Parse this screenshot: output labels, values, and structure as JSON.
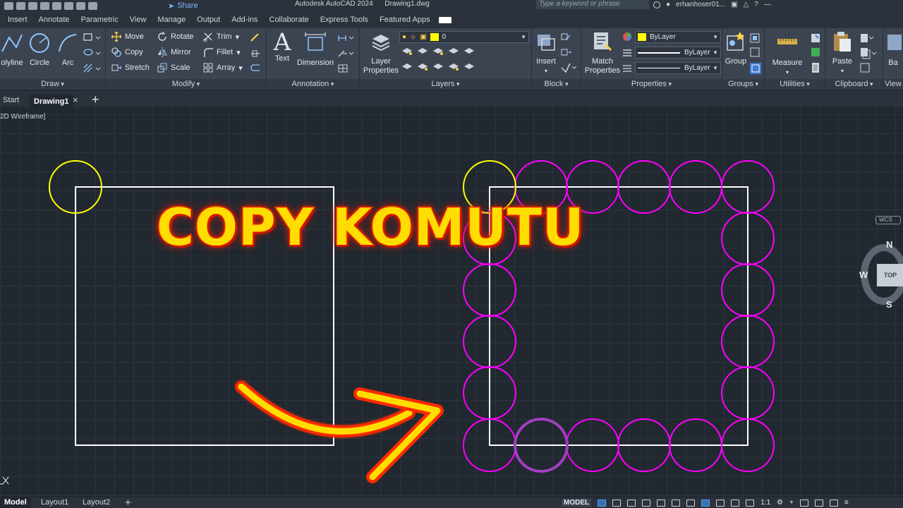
{
  "titlebar": {
    "share_label": "Share",
    "app_name": "Autodesk AutoCAD 2024",
    "file_name": "Drawing1.dwg",
    "search_placeholder": "Type a keyword or phrase",
    "user": "erhanhoser01..."
  },
  "menu": [
    "Insert",
    "Annotate",
    "Parametric",
    "View",
    "Manage",
    "Output",
    "Add-ins",
    "Collaborate",
    "Express Tools",
    "Featured Apps"
  ],
  "ribbon": {
    "draw": {
      "title": "Draw",
      "polyline": "olyline",
      "circle": "Circle",
      "arc": "Arc"
    },
    "modify": {
      "title": "Modify",
      "move": "Move",
      "rotate": "Rotate",
      "trim": "Trim",
      "copy": "Copy",
      "mirror": "Mirror",
      "fillet": "Fillet",
      "stretch": "Stretch",
      "scale": "Scale",
      "array": "Array"
    },
    "annotation": {
      "title": "Annotation",
      "text": "Text",
      "dimension": "Dimension"
    },
    "layers": {
      "title": "Layers",
      "layer_properties_1": "Layer",
      "layer_properties_2": "Properties",
      "current_layer": "0"
    },
    "block": {
      "title": "Block",
      "insert": "Insert"
    },
    "properties": {
      "title": "Properties",
      "match_1": "Match",
      "match_2": "Properties",
      "color": "ByLayer",
      "linetype": "ByLayer",
      "lineweight": "ByLayer",
      "color_hex": "#ffff00"
    },
    "groups": {
      "title": "Groups",
      "group": "Group"
    },
    "utilities": {
      "title": "Utilities",
      "measure": "Measure"
    },
    "clipboard": {
      "title": "Clipboard",
      "paste": "Paste"
    },
    "view": {
      "title": "View",
      "base": "Ba"
    }
  },
  "filetabs": {
    "start": "Start",
    "drawing": "Drawing1"
  },
  "viewport": {
    "label": "2D Wireframe]"
  },
  "overlay": {
    "headline": "COPY KOMUTU"
  },
  "viewcube": {
    "top": "TOP",
    "north": "N",
    "south": "S",
    "west": "W",
    "wcs": "WCS"
  },
  "statusbar": {
    "model_tab": "Model",
    "layout1": "Layout1",
    "layout2": "Layout2",
    "model_button": "MODEL",
    "scale": "1:1"
  },
  "colors": {
    "source_circle": "#ffff00",
    "copied_circles": "#ff00ff",
    "selected_circle": "#a040c0",
    "rectangle": "#ffffff",
    "headline": "#ffdd00",
    "arrow": "#ff2a00"
  }
}
